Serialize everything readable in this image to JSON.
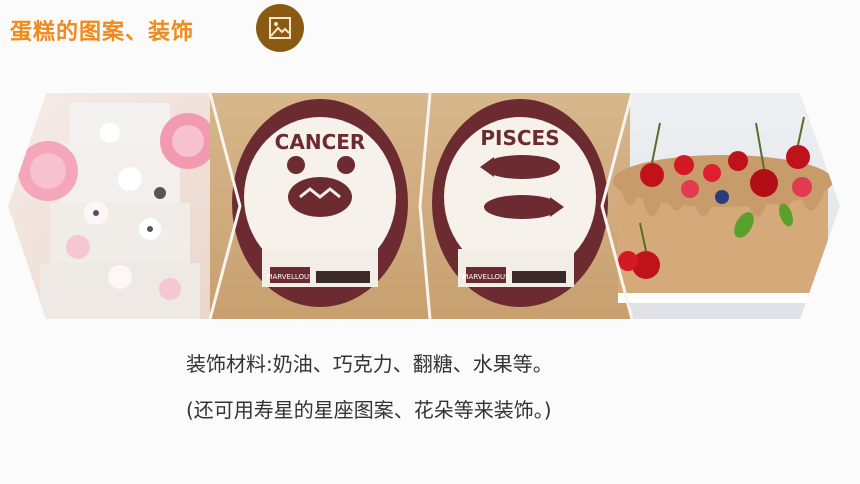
{
  "header": {
    "title": "蛋糕的图案、装饰",
    "icon": "image-icon"
  },
  "gallery": {
    "panels": [
      {
        "name": "flower-tier-cake"
      },
      {
        "name": "cancer-cake",
        "text": "CANCER",
        "brand": "MARVELLOUS"
      },
      {
        "name": "pisces-cake",
        "text": "PISCES",
        "brand": "MARVELLOUS"
      },
      {
        "name": "cherry-drip-cake"
      }
    ]
  },
  "caption": {
    "line1": "装饰材料:奶油、巧克力、翻糖、水果等。",
    "line2": "(还可用寿星的星座图案、花朵等来装饰。)"
  },
  "colors": {
    "accent": "#f08a1c",
    "icon_bg": "#8a5a12",
    "text": "#333333"
  }
}
